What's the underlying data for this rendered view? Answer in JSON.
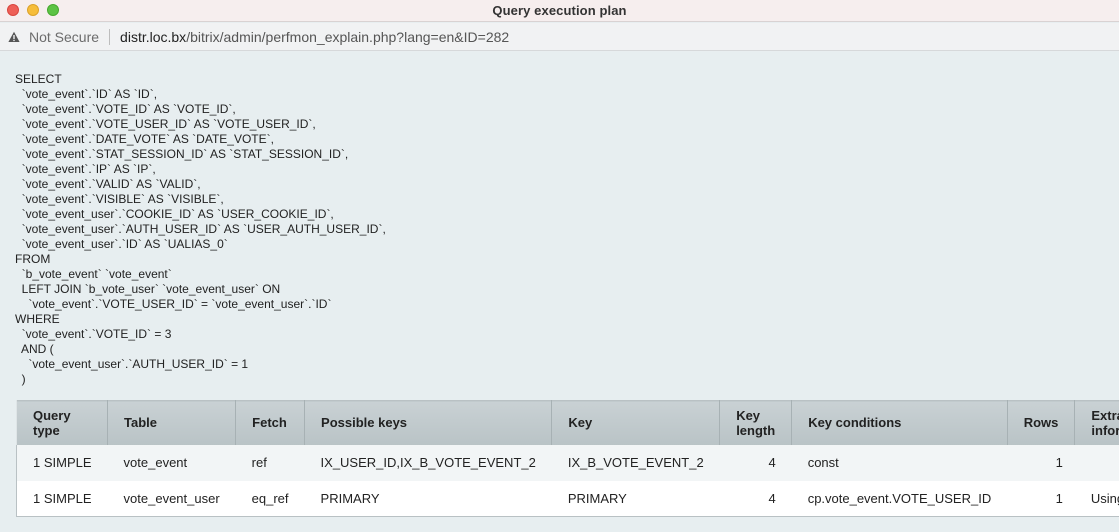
{
  "window": {
    "title": "Query execution plan",
    "controls": [
      "close",
      "minimize",
      "maximize"
    ]
  },
  "addressbar": {
    "security_icon": "warning-triangle-icon",
    "security_label": "Not Secure",
    "url_host": "distr.loc.bx",
    "url_path": "/bitrix/admin/perfmon_explain.php?lang=en&ID=282"
  },
  "sql": {
    "lines": [
      "SELECT",
      "  `vote_event`.`ID` AS `ID`,",
      "  `vote_event`.`VOTE_ID` AS `VOTE_ID`,",
      "  `vote_event`.`VOTE_USER_ID` AS `VOTE_USER_ID`,",
      "  `vote_event`.`DATE_VOTE` AS `DATE_VOTE`,",
      "  `vote_event`.`STAT_SESSION_ID` AS `STAT_SESSION_ID`,",
      "  `vote_event`.`IP` AS `IP`,",
      "  `vote_event`.`VALID` AS `VALID`,",
      "  `vote_event`.`VISIBLE` AS `VISIBLE`,",
      "  `vote_event_user`.`COOKIE_ID` AS `USER_COOKIE_ID`,",
      "  `vote_event_user`.`AUTH_USER_ID` AS `USER_AUTH_USER_ID`,",
      "  `vote_event_user`.`ID` AS `UALIAS_0`",
      "FROM",
      "  `b_vote_event` `vote_event`",
      "  LEFT JOIN `b_vote_user` `vote_event_user` ON",
      "    `vote_event`.`VOTE_USER_ID` = `vote_event_user`.`ID`",
      "WHERE",
      "  `vote_event`.`VOTE_ID` = 3",
      "  AND (",
      "    `vote_event_user`.`AUTH_USER_ID` = 1",
      "  )"
    ]
  },
  "plan": {
    "headers": [
      "Query\ntype",
      "Table",
      "Fetch",
      "Possible keys",
      "Key",
      "Key\nlength",
      "Key conditions",
      "Rows",
      "Extra\ninformation"
    ],
    "rows": [
      [
        "1 SIMPLE",
        "vote_event",
        "ref",
        "IX_USER_ID,IX_B_VOTE_EVENT_2",
        "IX_B_VOTE_EVENT_2",
        "4",
        "const",
        "1",
        ""
      ],
      [
        "1 SIMPLE",
        "vote_event_user",
        "eq_ref",
        "PRIMARY",
        "PRIMARY",
        "4",
        "cp.vote_event.VOTE_USER_ID",
        "1",
        "Using where"
      ]
    ]
  }
}
